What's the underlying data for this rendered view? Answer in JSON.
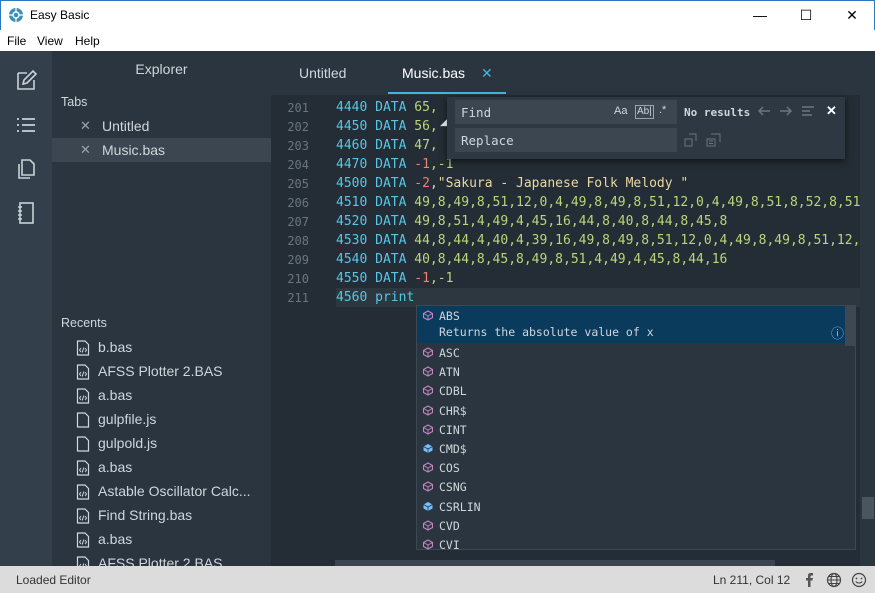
{
  "window": {
    "title": "Easy Basic",
    "minimize": "—",
    "maximize": "☐",
    "close": "✕"
  },
  "menu": [
    "File",
    "View",
    "Help"
  ],
  "activity_icons": [
    "edit-icon",
    "list-icon",
    "files-icon",
    "notebook-icon"
  ],
  "sidebar": {
    "title": "Explorer",
    "tabs_heading": "Tabs",
    "tabs": [
      {
        "label": "Untitled",
        "close": "✕"
      },
      {
        "label": "Music.bas",
        "close": "✕"
      }
    ],
    "recents_heading": "Recents",
    "recents": [
      {
        "label": "b.bas",
        "icon": "code-file-icon"
      },
      {
        "label": "AFSS Plotter 2.BAS",
        "icon": "code-file-icon"
      },
      {
        "label": "a.bas",
        "icon": "code-file-icon"
      },
      {
        "label": "gulpfile.js",
        "icon": "file-icon"
      },
      {
        "label": "gulpold.js",
        "icon": "file-icon"
      },
      {
        "label": "a.bas",
        "icon": "code-file-icon"
      },
      {
        "label": "Astable Oscillator Calc...",
        "icon": "code-file-icon"
      },
      {
        "label": "Find String.bas",
        "icon": "code-file-icon"
      },
      {
        "label": "a.bas",
        "icon": "code-file-icon"
      },
      {
        "label": "AFSS Plotter 2.BAS",
        "icon": "code-file-icon"
      }
    ]
  },
  "editor": {
    "tabs": [
      {
        "label": "Untitled"
      },
      {
        "label": "Music.bas",
        "close": "✕"
      }
    ],
    "lines": [
      {
        "no": "201",
        "ln": "4440",
        "kw": "DATA",
        "rest": "65,"
      },
      {
        "no": "202",
        "ln": "4450",
        "kw": "DATA",
        "rest": "56,"
      },
      {
        "no": "203",
        "ln": "4460",
        "kw": "DATA",
        "rest": "47,"
      },
      {
        "no": "204",
        "ln": "4470",
        "kw": "DATA",
        "neg": "-1",
        "rest": ",-1"
      },
      {
        "no": "205",
        "ln": "4500",
        "kw": "DATA",
        "neg": "-2",
        "str": ",\"Sakura - Japanese Folk Melody \""
      },
      {
        "no": "206",
        "ln": "4510",
        "kw": "DATA",
        "rest": "49,8,49,8,51,12,0,4,49,8,49,8,51,12,0,4,49,8,51,8,52,8,51"
      },
      {
        "no": "207",
        "ln": "4520",
        "kw": "DATA",
        "rest": "49,8,51,4,49,4,45,16,44,8,40,8,44,8,45,8"
      },
      {
        "no": "208",
        "ln": "4530",
        "kw": "DATA",
        "rest": "44,8,44,4,40,4,39,16,49,8,49,8,51,12,0,4,49,8,49,8,51,12,0"
      },
      {
        "no": "209",
        "ln": "4540",
        "kw": "DATA",
        "rest": "40,8,44,8,45,8,49,8,51,4,49,4,45,8,44,16"
      },
      {
        "no": "210",
        "ln": "4550",
        "kw": "DATA",
        "neg": "-1",
        "rest": ",-1"
      },
      {
        "no": "211",
        "ln": "4560",
        "kw": "print",
        "rest": ""
      }
    ]
  },
  "find": {
    "find_placeholder": "Find",
    "replace_placeholder": "Replace",
    "match_case": "Aa",
    "whole_word": "Ab|",
    "regex": ".*",
    "results": "No results",
    "close": "✕"
  },
  "suggest": {
    "items": [
      {
        "label": "ABS",
        "detail": "Returns the absolute value of x",
        "icon": "method-icon",
        "color": "#c586c0"
      },
      {
        "label": "ASC",
        "icon": "method-icon",
        "color": "#c586c0"
      },
      {
        "label": "ATN",
        "icon": "method-icon",
        "color": "#c586c0"
      },
      {
        "label": "CDBL",
        "icon": "method-icon",
        "color": "#c586c0"
      },
      {
        "label": "CHR$",
        "icon": "method-icon",
        "color": "#c586c0"
      },
      {
        "label": "CINT",
        "icon": "method-icon",
        "color": "#c586c0"
      },
      {
        "label": "CMD$",
        "icon": "variable-icon",
        "color": "#75beff"
      },
      {
        "label": "COS",
        "icon": "method-icon",
        "color": "#c586c0"
      },
      {
        "label": "CSNG",
        "icon": "method-icon",
        "color": "#c586c0"
      },
      {
        "label": "CSRLIN",
        "icon": "variable-icon",
        "color": "#75beff"
      },
      {
        "label": "CVD",
        "icon": "method-icon",
        "color": "#c586c0"
      },
      {
        "label": "CVI",
        "icon": "method-icon",
        "color": "#c586c0"
      }
    ],
    "info": "ⓘ"
  },
  "status": {
    "left": "Loaded Editor",
    "position": "Ln 211, Col 12"
  },
  "colors": {
    "accent": "#3fb6df",
    "sidebar_bg": "#2b353f",
    "editor_bg": "#242d35",
    "activity_bg": "#333f4a"
  }
}
